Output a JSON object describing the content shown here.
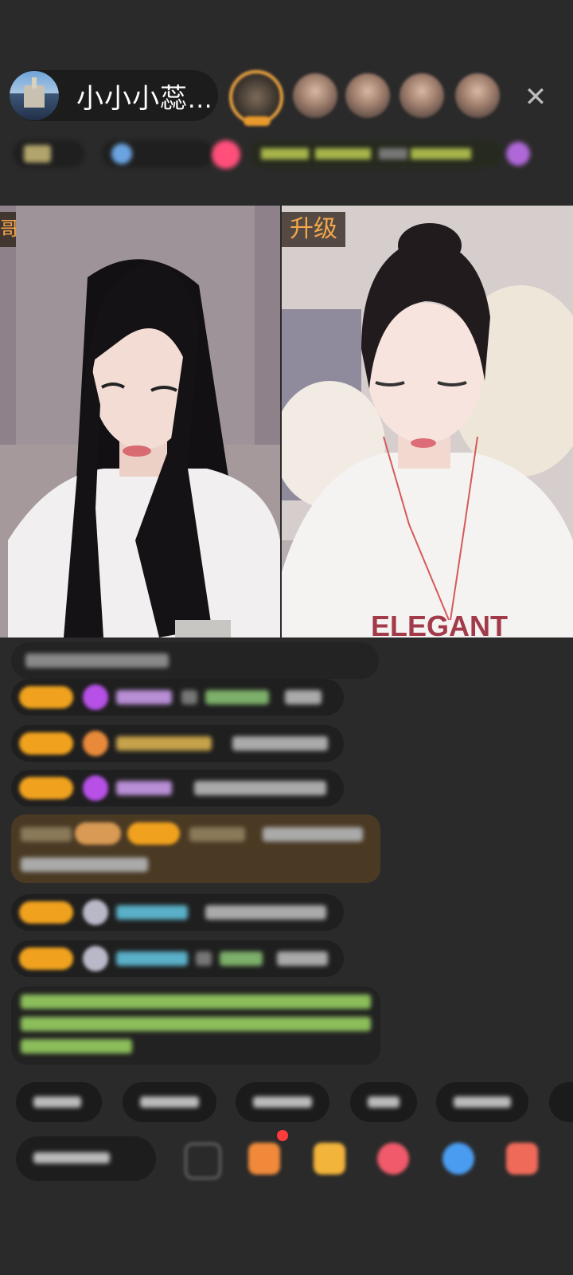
{
  "header": {
    "host_name": "小小小蕊...",
    "close_icon": "close-icon"
  },
  "video": {
    "left_tag": "哥",
    "right_tag": "升级",
    "right_shirt_text": "ELEGANT"
  },
  "colors": {
    "level_badge": "#f0a21e",
    "tag_text": "#f4a64a",
    "background": "#2a2a2a"
  }
}
